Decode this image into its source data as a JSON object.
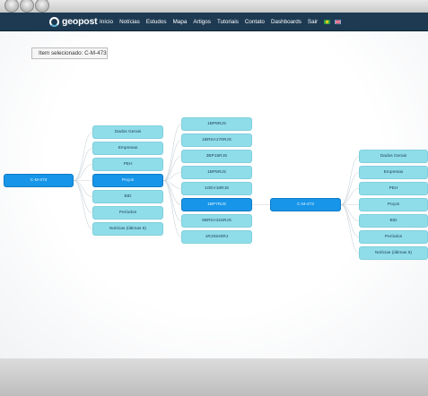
{
  "brand": {
    "name": "geopost"
  },
  "nav": {
    "items": [
      "Início",
      "Notícias",
      "Estudos",
      "Mapa",
      "Artigos",
      "Tutoriais",
      "Contato",
      "Dashboards",
      "Sair"
    ]
  },
  "selected_panel": {
    "label": "Item selecionado: C-M-473"
  },
  "tree": {
    "root": {
      "label": "C-M-473"
    },
    "categories": [
      "Dados Gerais",
      "Empresas",
      "PEH",
      "Poços",
      "BID",
      "Períodos",
      "Notícias (últimas 5)"
    ],
    "selected_category": "Poços",
    "wells": [
      "1BP6RJS",
      "1BRSA176RJS",
      "3BP15RJS",
      "1BP5RJS",
      "1OEV16RJS",
      "1BP7RJS",
      "6BRSA315RJS",
      "1RJS540RJ"
    ],
    "selected_well": "1BP7RJS",
    "second_root": {
      "label": "C-M-473"
    },
    "second_categories": [
      "Dados Gerais",
      "Empresas",
      "PEH",
      "Poços",
      "BID",
      "Períodos",
      "Notícias (últimas 5)"
    ]
  }
}
